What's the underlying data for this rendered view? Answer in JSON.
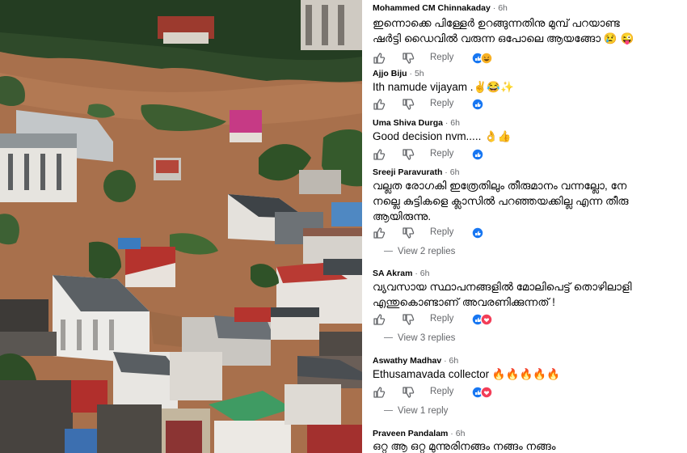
{
  "comments": [
    {
      "author": "Mohammed CM Chinnakaday",
      "time": "6h",
      "lines": [
        "ഇന്നൊക്കെ പിള്ളേർ ഉറങ്ങുന്നതിനു മുമ്പ് പറയാണ്ട",
        "ഷർട്ടി ഡൈവിൽ വരുന്ന ഒപോലെ ആയങ്ങോ"
      ],
      "emoji": "😢 😜",
      "reply_label": "Reply",
      "reactions": [
        "like",
        "haha"
      ]
    },
    {
      "author": "Ajjo Biju",
      "time": "5h",
      "lines": [
        "Ith namude vijayam .✌😂✨"
      ],
      "reply_label": "Reply",
      "reactions": [
        "like"
      ]
    },
    {
      "author": "Uma Shiva Durga",
      "time": "6h",
      "lines": [
        "Good decision nvm..... 👌👍"
      ],
      "reply_label": "Reply",
      "reactions": [
        "like"
      ]
    },
    {
      "author": "Sreeji Paravurath",
      "time": "6h",
      "lines": [
        "വല്ലത രോഗകി ഇത്രേതിലും തീരുമാനം വന്നല്ലോ, നേ",
        "നല്ലെ കുട്ടികളെ ക്ലാസിൽ പറഞ്ഞയക്കില്ല എന്ന തീരു",
        "ആയിരുന്നു."
      ],
      "reply_label": "Reply",
      "reactions": [
        "like"
      ],
      "view_replies": "View 2 replies"
    },
    {
      "author": "SA Akram",
      "time": "6h",
      "lines": [
        "വ്യവസായ സ്ഥാപനങ്ങളിൽ മോലിപെട്ട് തൊഴിലാളി",
        "എന്തുകൊണ്ടാണ് അവരണിക്കുന്നത് !"
      ],
      "reply_label": "Reply",
      "reactions": [
        "like",
        "love"
      ],
      "view_replies": "View 3 replies"
    },
    {
      "author": "Aswathy Madhav",
      "time": "6h",
      "lines": [
        "Ethusamavada collector 🔥🔥🔥🔥🔥"
      ],
      "reply_label": "Reply",
      "reactions": [
        "like",
        "love"
      ],
      "view_replies": "View 1 reply"
    },
    {
      "author": "Praveen Pandalam",
      "time": "6h",
      "lines": [
        "ഒറ്റ ആ ഒറ്റ മുന്നുരിനങ്ങം നങ്ങം നങ്ങം"
      ]
    }
  ],
  "icons": {
    "like": "thumbs-up-icon",
    "dislike": "thumbs-down-icon"
  },
  "colors": {
    "like_blue": "#1877f2",
    "love_red": "#f33e58",
    "haha_yellow": "#f7b125",
    "muted": "#65676b"
  }
}
